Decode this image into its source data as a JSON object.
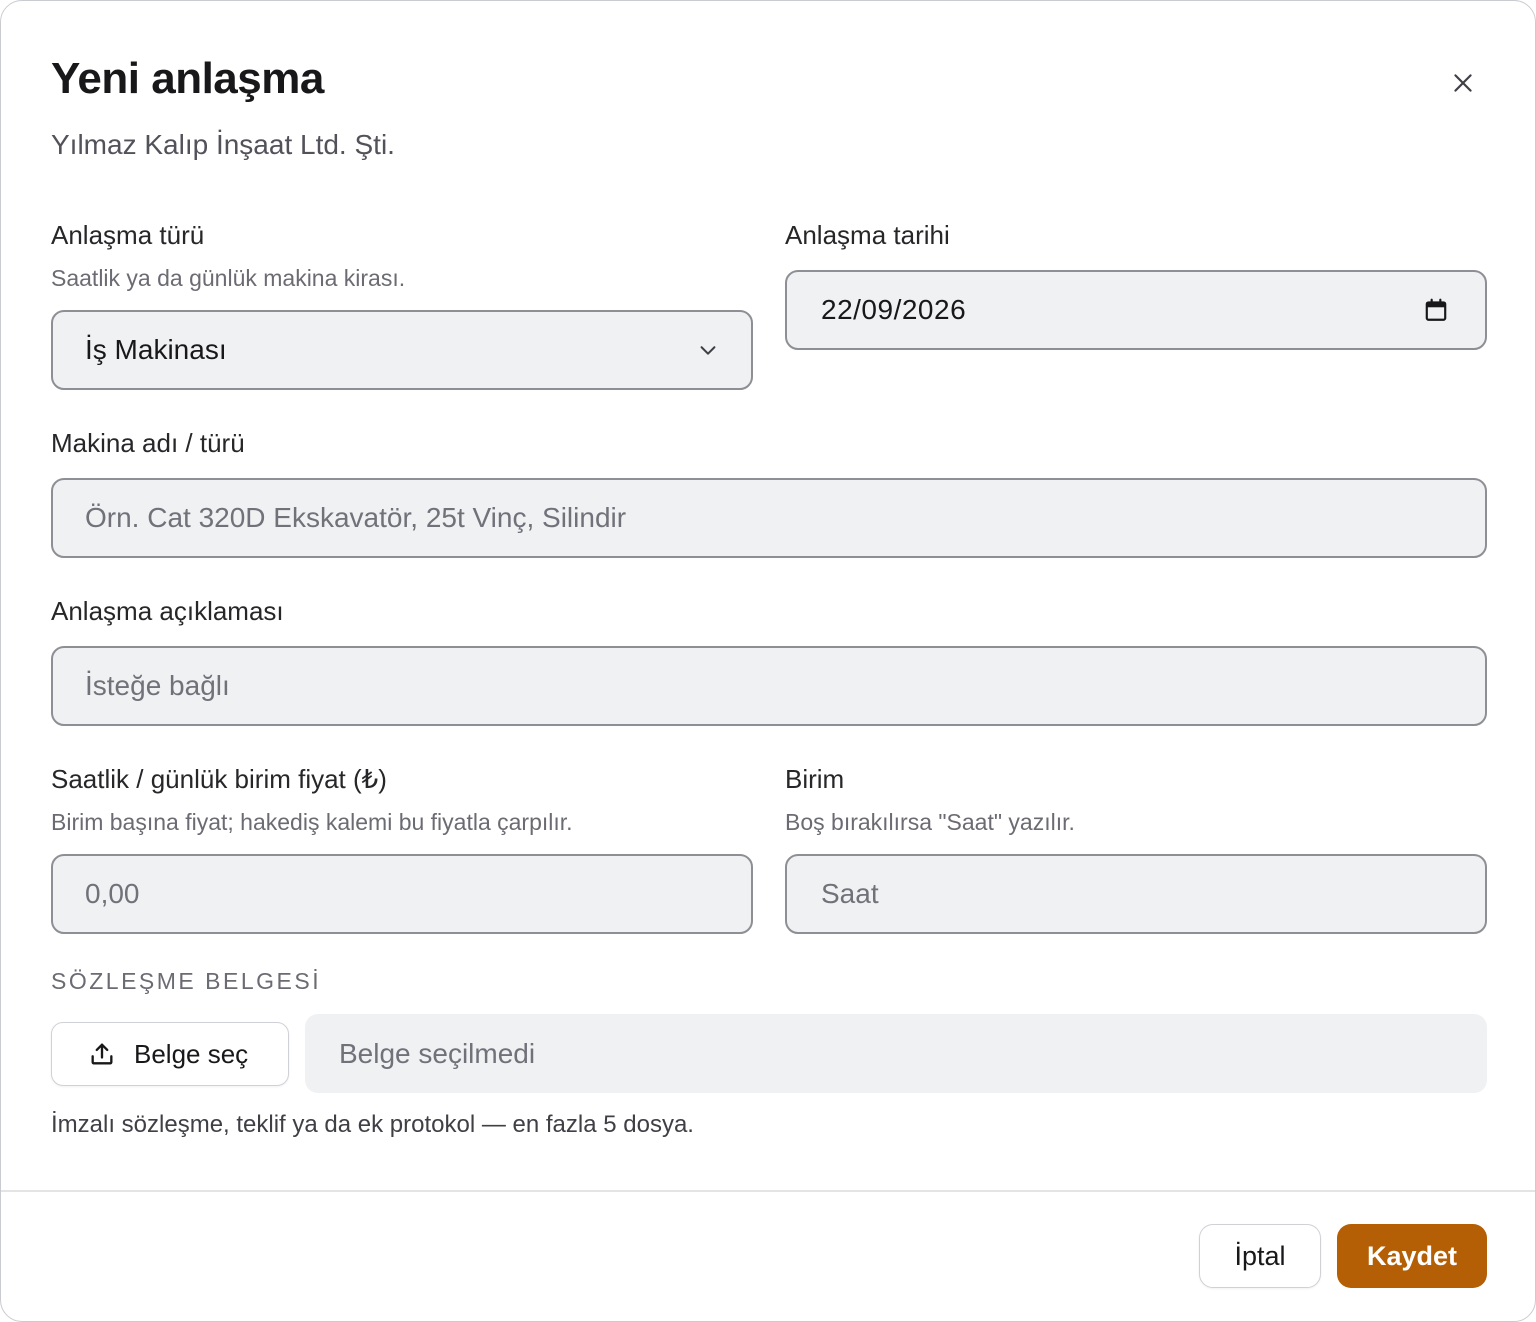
{
  "dialog": {
    "title": "Yeni anlaşma",
    "subtitle": "Yılmaz Kalıp İnşaat Ltd. Şti."
  },
  "form": {
    "deal_type": {
      "label": "Anlaşma türü",
      "hint": "Saatlik ya da günlük makina kirası.",
      "value": "İş Makinası"
    },
    "deal_date": {
      "label": "Anlaşma tarihi",
      "value": "22/09/2026"
    },
    "machine": {
      "label": "Makina adı / türü",
      "placeholder": "Örn. Cat 320D Ekskavatör, 25t Vinç, Silindir"
    },
    "description": {
      "label": "Anlaşma açıklaması",
      "placeholder": "İsteğe bağlı"
    },
    "unit_price": {
      "label": "Saatlik / günlük birim fiyat (₺)",
      "hint": "Birim başına fiyat; hakediş kalemi bu fiyatla çarpılır.",
      "placeholder": "0,00"
    },
    "unit": {
      "label": "Birim",
      "hint": "Boş bırakılırsa \"Saat\" yazılır.",
      "placeholder": "Saat"
    }
  },
  "attachments": {
    "section_title": "SÖZLEŞME BELGESİ",
    "button_label": "Belge seç",
    "status": "Belge seçilmedi",
    "help": "İmzalı sözleşme, teklif ya da ek protokol — en fazla 5 dosya."
  },
  "footer": {
    "cancel_label": "İptal",
    "save_label": "Kaydet"
  },
  "colors": {
    "accent": "#b45f06",
    "field_bg": "#f0f1f3",
    "field_border": "#8d8f95"
  },
  "icons": {
    "close": "close-icon",
    "select": "chevron-down-icon",
    "date": "calendar-icon",
    "upload": "upload-icon"
  }
}
